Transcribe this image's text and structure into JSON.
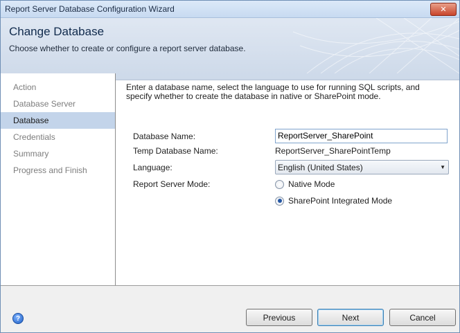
{
  "window": {
    "title": "Report Server Database Configuration Wizard",
    "close_label": "✕"
  },
  "header": {
    "title": "Change Database",
    "subtitle": "Choose whether to create or configure a report server database."
  },
  "nav": {
    "items": [
      {
        "label": "Action"
      },
      {
        "label": "Database Server"
      },
      {
        "label": "Database"
      },
      {
        "label": "Credentials"
      },
      {
        "label": "Summary"
      },
      {
        "label": "Progress and Finish"
      }
    ],
    "active": "Database"
  },
  "main": {
    "intro": "Enter a database name, select the language to use for running SQL scripts, and specify whether to create the database in native or SharePoint mode.",
    "db_name_label": "Database Name:",
    "db_name_value": "ReportServer_SharePoint",
    "temp_db_label": "Temp Database Name:",
    "temp_db_value": "ReportServer_SharePointTemp",
    "language_label": "Language:",
    "language_value": "English (United States)",
    "mode_label": "Report Server Mode:",
    "mode_native": "Native Mode",
    "mode_sharepoint": "SharePoint Integrated Mode",
    "mode_selected": "SharePoint Integrated Mode"
  },
  "footer": {
    "help_glyph": "?",
    "previous": "Previous",
    "next": "Next",
    "cancel": "Cancel"
  }
}
